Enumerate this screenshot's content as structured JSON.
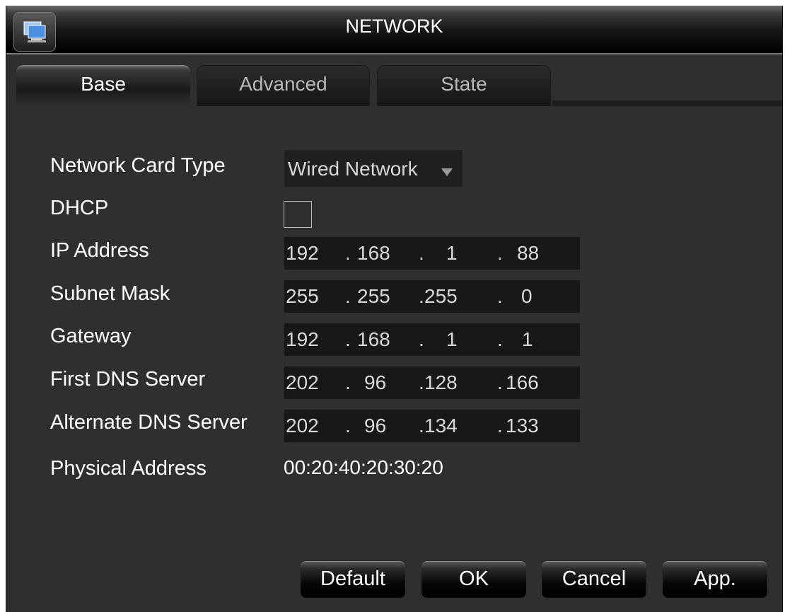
{
  "window": {
    "title": "NETWORK",
    "icon": "monitor-icon"
  },
  "tabs": [
    {
      "label": "Base",
      "active": true
    },
    {
      "label": "Advanced",
      "active": false
    },
    {
      "label": "State",
      "active": false
    }
  ],
  "form": {
    "network_card_type": {
      "label": "Network Card Type",
      "value": "Wired Network"
    },
    "dhcp": {
      "label": "DHCP",
      "checked": false
    },
    "ip_address": {
      "label": "IP Address",
      "octets": [
        "192",
        "168",
        "1",
        "88"
      ]
    },
    "subnet_mask": {
      "label": "Subnet Mask",
      "octets": [
        "255",
        "255",
        "255",
        "0"
      ]
    },
    "gateway": {
      "label": "Gateway",
      "octets": [
        "192",
        "168",
        "1",
        "1"
      ]
    },
    "first_dns": {
      "label": "First DNS Server",
      "octets": [
        "202",
        "96",
        "128",
        "166"
      ]
    },
    "alternate_dns": {
      "label": "Alternate DNS Server",
      "octets": [
        "202",
        "96",
        "134",
        "133"
      ]
    },
    "physical_address": {
      "label": "Physical Address",
      "value": "00:20:40:20:30:20"
    },
    "octet_separator": "."
  },
  "buttons": {
    "default": "Default",
    "ok": "OK",
    "cancel": "Cancel",
    "apply": "App."
  },
  "colors": {
    "panel_bg": "#2f2f2f",
    "field_bg": "#181818",
    "text": "#ffffff",
    "field_text": "#d8d8d8",
    "inactive_tab_text": "#b8b8b8"
  }
}
